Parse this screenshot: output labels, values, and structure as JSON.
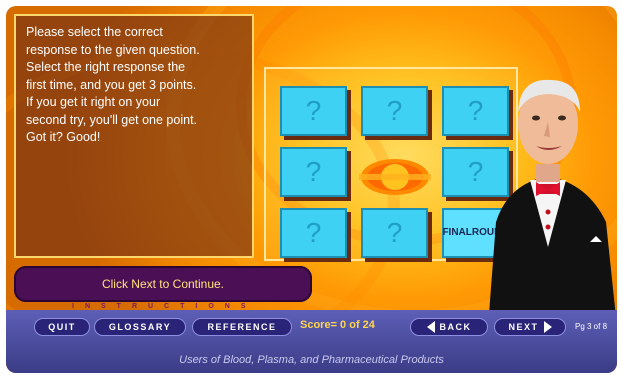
{
  "instructions": {
    "lines": [
      "Please select the correct",
      "response to the given question.",
      "Select the right response the",
      "first time, and you get 3 points.",
      "If you get it right on your",
      "second try, you'll get one point.",
      "Got it? Good!"
    ]
  },
  "board": {
    "tiles": [
      "?",
      "?",
      "?",
      "?",
      "?",
      "?",
      "?"
    ],
    "final_round_line1": "FINAL",
    "final_round_line2": "ROUND"
  },
  "continue_text": "Click Next to Continue.",
  "instructions_label": "INSTRUCTIONS",
  "nav": {
    "quit": "QUIT",
    "glossary": "GLOSSARY",
    "reference": "REFERENCE",
    "score": "Score= 0 of 24",
    "back": "BACK",
    "next": "NEXT",
    "page": "Pg 3 of 8"
  },
  "footer": "Users of Blood, Plasma, and Pharmaceutical Products",
  "colors": {
    "tile": "#3fd1f4",
    "background": "#ffc21e",
    "navbar": "#4b4c9c",
    "score": "#ffd54a"
  }
}
